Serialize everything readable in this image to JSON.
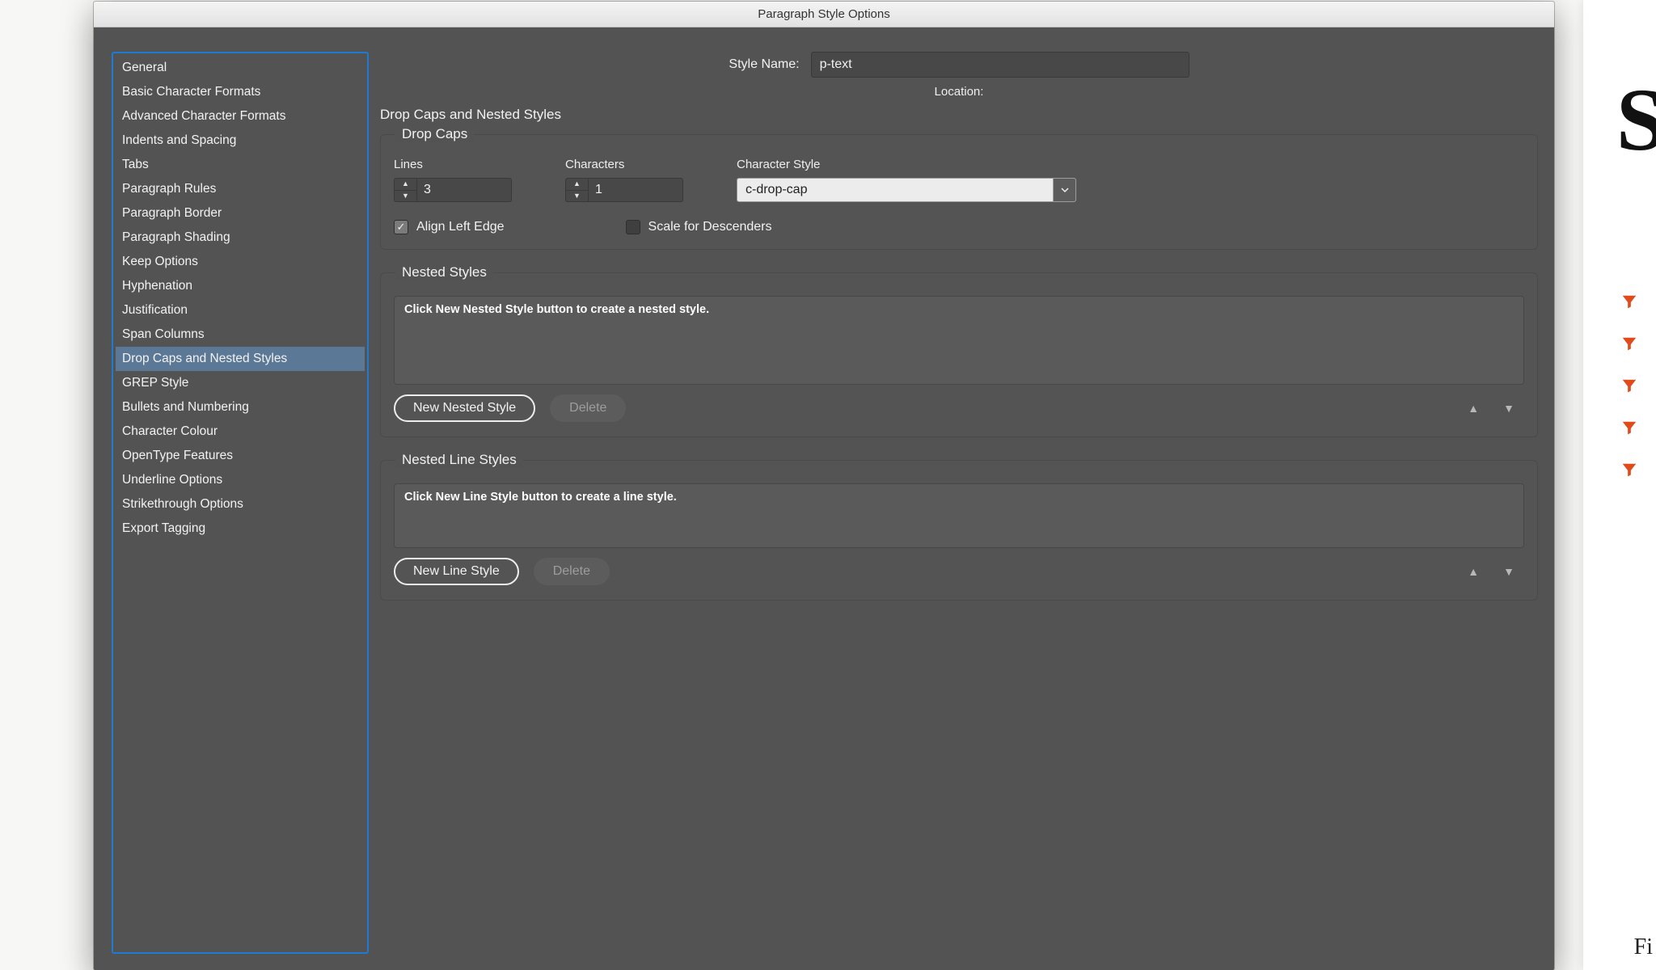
{
  "window_title": "Paragraph Style Options",
  "sidebar": {
    "items": [
      "General",
      "Basic Character Formats",
      "Advanced Character Formats",
      "Indents and Spacing",
      "Tabs",
      "Paragraph Rules",
      "Paragraph Border",
      "Paragraph Shading",
      "Keep Options",
      "Hyphenation",
      "Justification",
      "Span Columns",
      "Drop Caps and Nested Styles",
      "GREP Style",
      "Bullets and Numbering",
      "Character Colour",
      "OpenType Features",
      "Underline Options",
      "Strikethrough Options",
      "Export Tagging"
    ],
    "selected_index": 12
  },
  "header": {
    "style_name_label": "Style Name:",
    "style_name": "p-text",
    "location_label": "Location:"
  },
  "section_heading": "Drop Caps and Nested Styles",
  "drop_caps": {
    "legend": "Drop Caps",
    "lines_label": "Lines",
    "lines_value": "3",
    "characters_label": "Characters",
    "characters_value": "1",
    "char_style_label": "Character Style",
    "char_style_value": "c-drop-cap",
    "align_left": {
      "label": "Align Left Edge",
      "checked": true
    },
    "scale_desc": {
      "label": "Scale for Descenders",
      "checked": false
    }
  },
  "nested_styles": {
    "legend": "Nested Styles",
    "placeholder": "Click New Nested Style button to create a nested style.",
    "new_btn": "New Nested Style",
    "delete_btn": "Delete"
  },
  "nested_line_styles": {
    "legend": "Nested Line Styles",
    "placeholder": "Click New Line Style button to create a line style.",
    "new_btn": "New Line Style",
    "delete_btn": "Delete"
  },
  "bg_page": {
    "big_letter": "S",
    "bottom_fragment": "Fi"
  }
}
